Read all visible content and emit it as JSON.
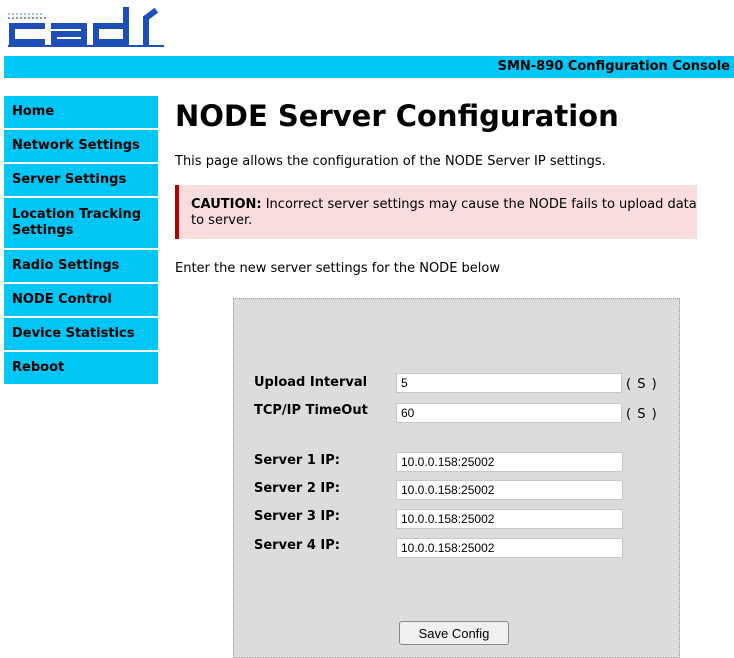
{
  "brand": {
    "logo_text": "cadi"
  },
  "banner": {
    "title": "SMN-890 Configuration Console"
  },
  "sidebar": {
    "items": [
      {
        "label": "Home"
      },
      {
        "label": "Network Settings"
      },
      {
        "label": "Server Settings"
      },
      {
        "label": "Location Tracking Settings"
      },
      {
        "label": "Radio Settings"
      },
      {
        "label": "NODE Control"
      },
      {
        "label": "Device Statistics"
      },
      {
        "label": "Reboot"
      }
    ]
  },
  "page": {
    "title": "NODE Server Configuration",
    "intro": "This page allows the configuration of the NODE Server IP settings.",
    "caution_label": "CAUTION:",
    "caution_text": " Incorrect server settings may cause the NODE fails to upload data to server.",
    "instruction": "Enter the new server settings for the NODE below"
  },
  "form": {
    "upload_interval": {
      "label": "Upload Interval",
      "value": "5",
      "unit": "( S )"
    },
    "tcp_timeout": {
      "label": "TCP/IP TimeOut",
      "value": "60",
      "unit": "( S )"
    },
    "servers": [
      {
        "label": "Server 1 IP:",
        "value": "10.0.0.158:25002"
      },
      {
        "label": "Server 2 IP:",
        "value": "10.0.0.158:25002"
      },
      {
        "label": "Server 3 IP:",
        "value": "10.0.0.158:25002"
      },
      {
        "label": "Server 4 IP:",
        "value": "10.0.0.158:25002"
      }
    ],
    "save_label": "Save Config"
  },
  "colors": {
    "accent": "#00c6f5",
    "logo": "#1e4fb8",
    "caution_bg": "#f9dcdc",
    "caution_border": "#b30000",
    "panel_bg": "#dcdcdc"
  }
}
